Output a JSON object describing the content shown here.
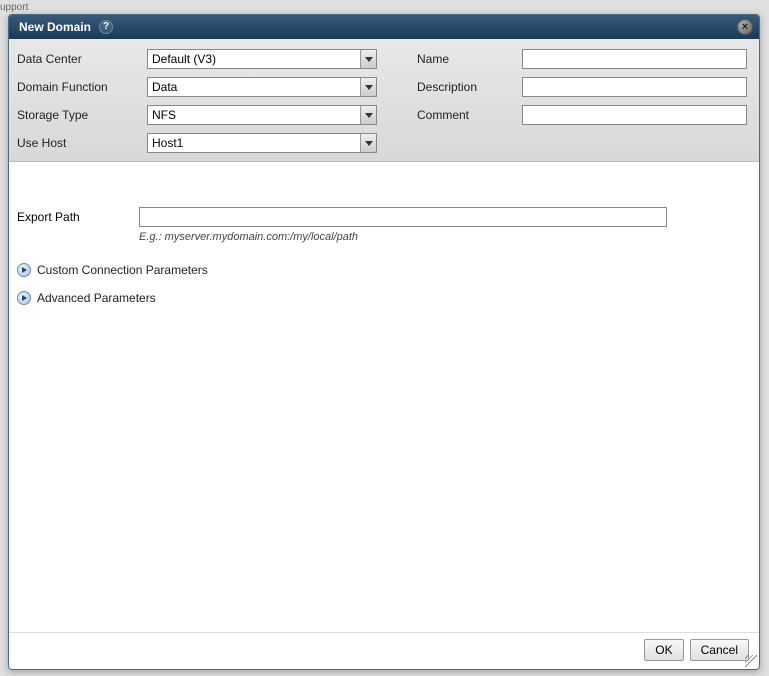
{
  "background_fragment": "upport",
  "dialog": {
    "title": "New Domain",
    "help_symbol": "?",
    "close_symbol": "×"
  },
  "fields": {
    "data_center": {
      "label": "Data Center",
      "value": "Default (V3)"
    },
    "domain_function": {
      "label": "Domain Function",
      "value": "Data"
    },
    "storage_type": {
      "label": "Storage Type",
      "value": "NFS"
    },
    "use_host": {
      "label": "Use Host",
      "value": "Host1"
    },
    "name": {
      "label": "Name",
      "value": ""
    },
    "description": {
      "label": "Description",
      "value": ""
    },
    "comment": {
      "label": "Comment",
      "value": ""
    },
    "export_path": {
      "label": "Export Path",
      "value": "",
      "hint": "E.g.: myserver.mydomain.com:/my/local/path"
    }
  },
  "expandables": {
    "custom_connection": "Custom Connection Parameters",
    "advanced": "Advanced Parameters"
  },
  "buttons": {
    "ok": "OK",
    "cancel": "Cancel"
  }
}
